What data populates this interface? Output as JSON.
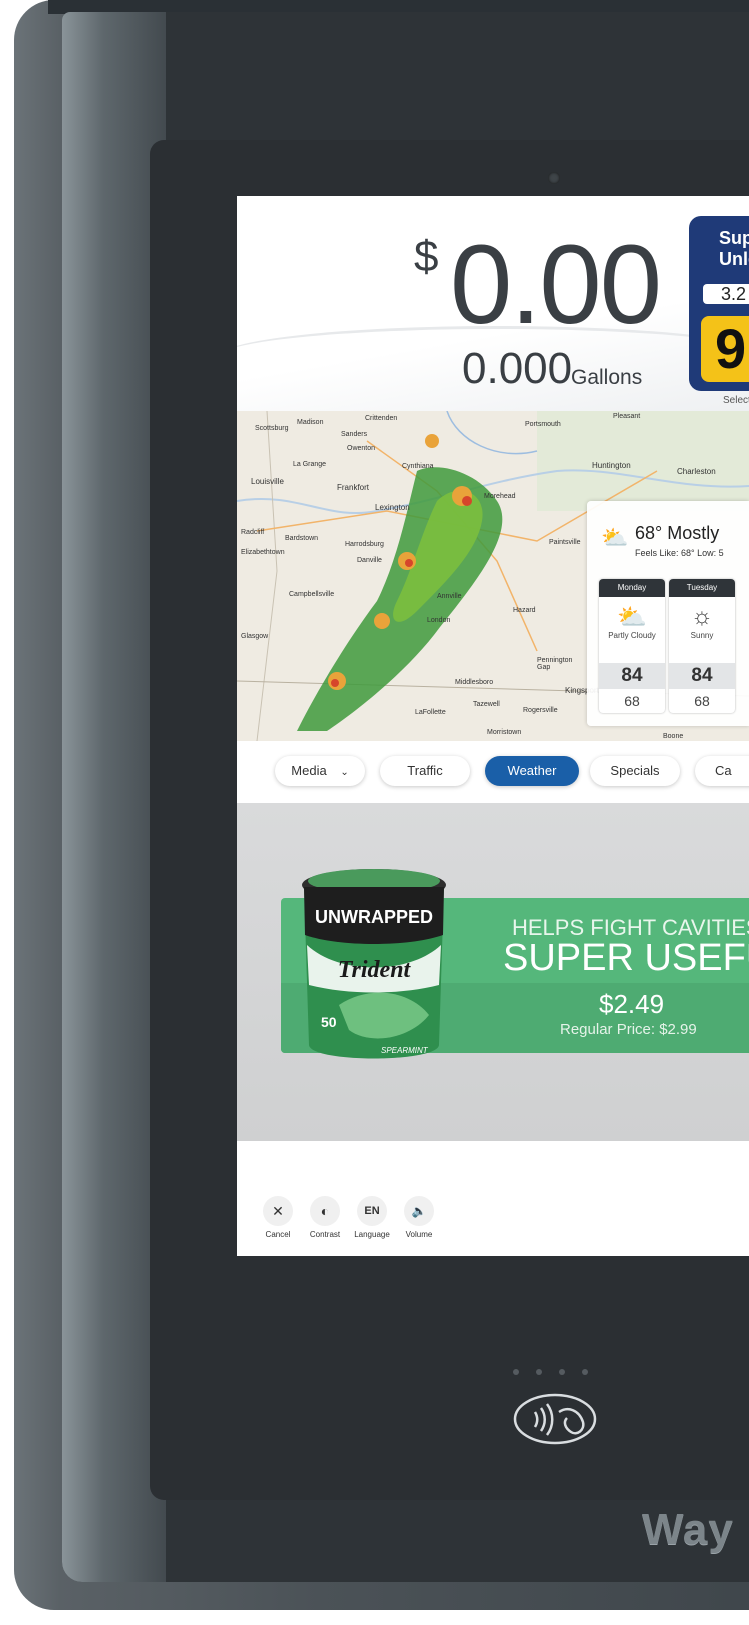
{
  "transaction": {
    "currency_symbol": "$",
    "amount": "0.00",
    "gallons": "0.000",
    "gallons_label": "Gallons"
  },
  "fuel_grade": {
    "name": "Sup\nUnle",
    "price": "3.2",
    "octane": "9",
    "status_label": "Selecte"
  },
  "map": {
    "cities": [
      "Scottsburg",
      "Madison",
      "Crittenden",
      "Portsmouth",
      "Sanders",
      "Owenton",
      "La Grange",
      "Louisville",
      "Frankfort",
      "Cynthiana",
      "Huntington",
      "Charleston",
      "Lexington",
      "Morehead",
      "Radcliff",
      "Bardstown",
      "Harrodsburg",
      "Elizabethtown",
      "Danville",
      "Paintsville",
      "Campbellsville",
      "Annville",
      "Hazard",
      "Glasgow",
      "London",
      "Pennington Gap",
      "Middlesboro",
      "LaFollette",
      "Kingsport",
      "Tazewell",
      "Rogersville",
      "Morristown",
      "Pleasant",
      "Boone"
    ]
  },
  "weather": {
    "current": "68° Mostly",
    "feels_like": "Feels Like: 68° Low: 5",
    "days": [
      {
        "name": "Monday",
        "condition": "Partly Cloudy",
        "icon": "partly-cloudy-icon",
        "high": "84",
        "low": "68"
      },
      {
        "name": "Tuesday",
        "condition": "Sunny",
        "icon": "sunny-icon",
        "high": "84",
        "low": "68"
      }
    ]
  },
  "tabs": [
    {
      "label": "Media",
      "active": false
    },
    {
      "label": "Traffic",
      "active": false
    },
    {
      "label": "Weather",
      "active": true
    },
    {
      "label": "Specials",
      "active": false
    },
    {
      "label": "Ca",
      "active": false
    }
  ],
  "promo": {
    "line1": "HELPS FIGHT CAVITIES",
    "line2": "SUPER USEFU",
    "price": "$2.49",
    "regular_price": "Regular Price: $2.99",
    "product_brand": "Trident",
    "product_name": "UNWRAPPED",
    "product_count": "50",
    "product_flavor": "SPEARMINT"
  },
  "controls": [
    {
      "label": "Cancel",
      "icon": "close-icon",
      "glyph": "✕"
    },
    {
      "label": "Contrast",
      "icon": "contrast-icon",
      "glyph": "◐"
    },
    {
      "label": "Language",
      "icon": "language-icon",
      "glyph": "EN"
    },
    {
      "label": "Volume",
      "icon": "volume-mute-icon",
      "glyph": "🔈"
    }
  ],
  "device": {
    "brand": "Way"
  },
  "colors": {
    "accent": "#1a5fa8",
    "grade_panel": "#1f3a78",
    "octane_badge": "#f4c218",
    "promo_green": "#55b77b"
  }
}
